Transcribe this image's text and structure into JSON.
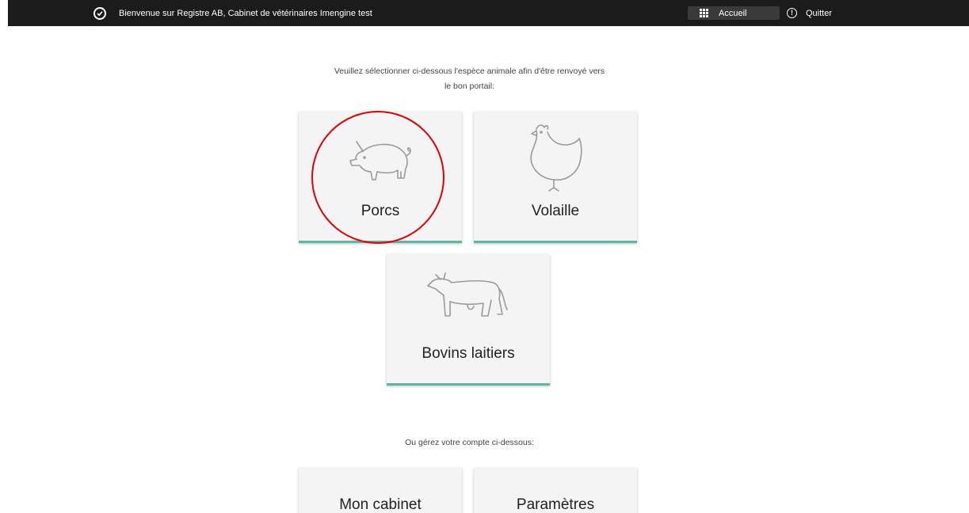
{
  "topbar": {
    "welcome_text": "Bienvenue sur Registre AB, Cabinet de vétérinaires Imengine test",
    "home_label": "Accueil",
    "quit_label": "Quitter",
    "quit_icon_glyph": "!",
    "background_color": "#1b1b1b"
  },
  "main": {
    "intro_line1": "Veuillez sélectionner ci-dessous l'espèce animale afin d'être renvoyé vers",
    "intro_line2": "le bon portail:",
    "species_cards": [
      {
        "label": "Porcs",
        "icon": "pig-icon"
      },
      {
        "label": "Volaille",
        "icon": "chicken-icon"
      },
      {
        "label": "Bovins laitiers",
        "icon": "cow-icon"
      }
    ],
    "manage_text": "Ou gérez votre compte ci-dessous:",
    "account_cards": [
      {
        "label": "Mon cabinet"
      },
      {
        "label": "Paramètres"
      }
    ]
  },
  "colors": {
    "card_background": "#f4f4f4",
    "card_accent": "#5fb5a8",
    "highlight_circle": "#e00000"
  }
}
